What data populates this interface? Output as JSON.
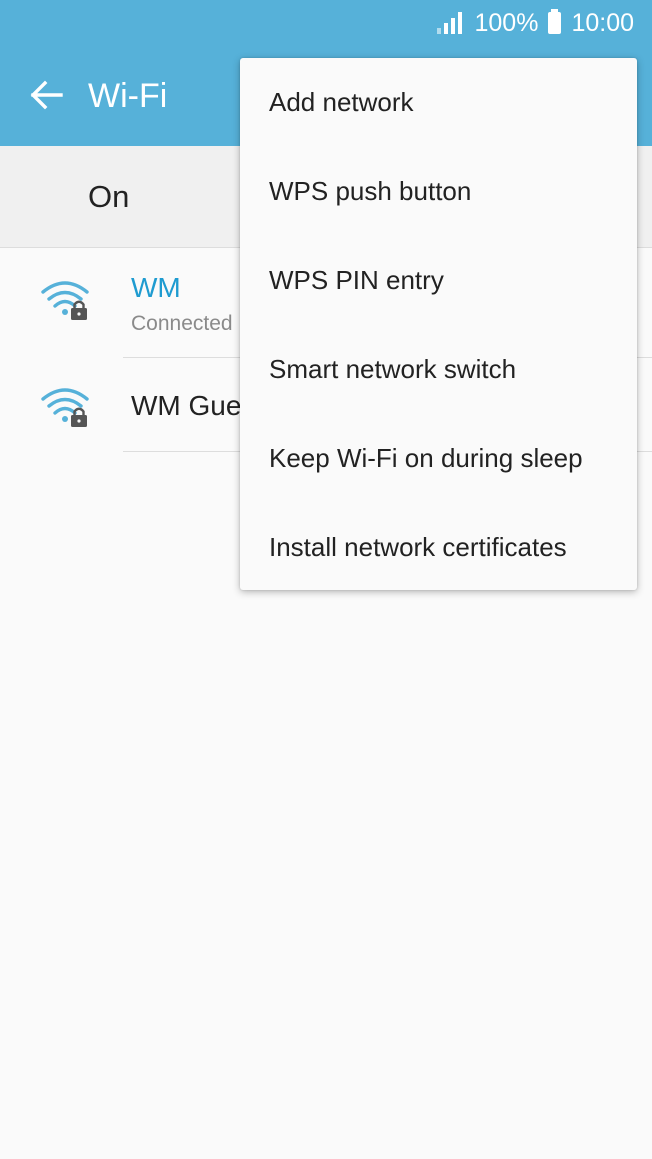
{
  "status_bar": {
    "battery": "100%",
    "time": "10:00",
    "icons": [
      "signal-icon",
      "battery-icon"
    ]
  },
  "app_bar": {
    "title": "Wi-Fi",
    "back_icon": "arrow-left-icon",
    "color": "#56b1d9"
  },
  "toggle": {
    "label": "On"
  },
  "networks": [
    {
      "name": "WM",
      "status": "Connected",
      "icon": "wifi-lock-icon",
      "name_color": "#1e9bd0"
    },
    {
      "name": "WM Guest",
      "status": "",
      "icon": "wifi-lock-icon",
      "name_color": "#222222"
    }
  ],
  "menu": {
    "items": [
      "Add network",
      "WPS push button",
      "WPS PIN entry",
      "Smart network switch",
      "Keep Wi-Fi on during sleep",
      "Install network certificates"
    ]
  },
  "colors": {
    "accent": "#56b1d9",
    "wifi_icon": "#56b1d9",
    "connected_name": "#1e9bd0"
  }
}
